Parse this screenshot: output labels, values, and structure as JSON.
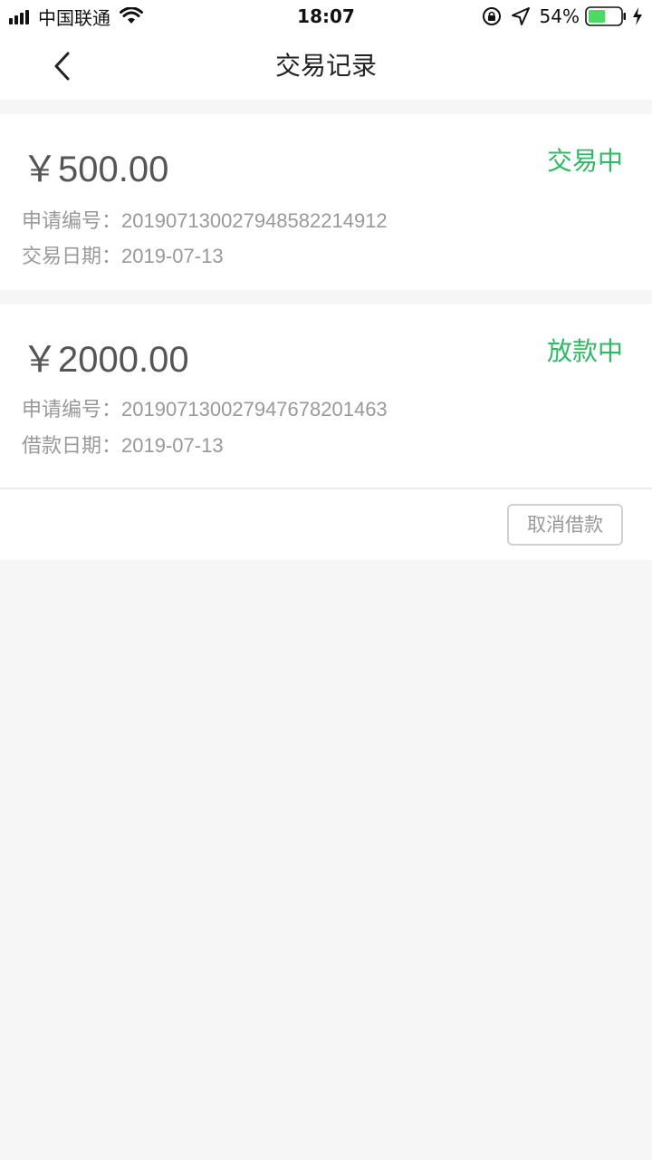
{
  "status_bar": {
    "carrier": "中国联通",
    "time": "18:07",
    "battery": "54%",
    "battery_level": 0.54,
    "icons": [
      "signal-icon",
      "wifi-icon",
      "rotation-lock-icon",
      "location-icon",
      "battery-icon",
      "charging-icon"
    ]
  },
  "nav": {
    "back_icon": "chevron-left-icon",
    "title": "交易记录"
  },
  "records": [
    {
      "amount": "￥500.00",
      "status": "交易中",
      "line1_label": "申请编号：",
      "line1_value": "2019071300279485822149 12",
      "line2_label": "交易日期：",
      "line2_value": "2019-07-13"
    },
    {
      "amount": "￥2000.00",
      "status": "放款中",
      "line1_label": "申请编号：",
      "line1_value": "20190713002794767820146 3",
      "line2_label": "借款日期：",
      "line2_value": "2019-07-13",
      "action_label": "取消借款"
    }
  ],
  "colors": {
    "status_green": "#2fb964",
    "background": "#f6f6f6",
    "card": "#ffffff"
  }
}
